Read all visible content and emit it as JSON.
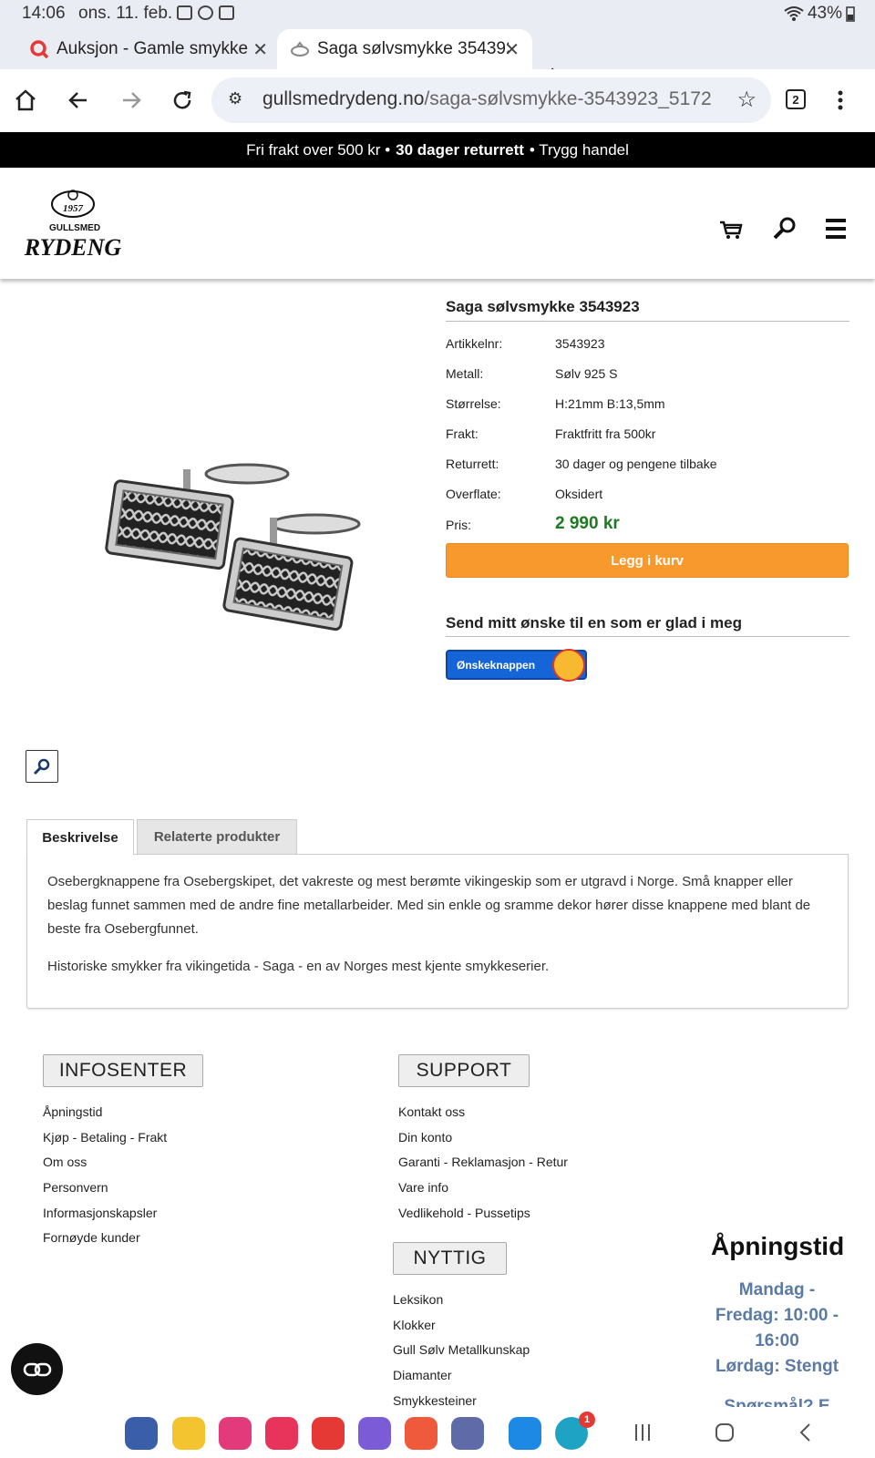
{
  "status_bar": {
    "time": "14:06",
    "date": "ons. 11. feb.",
    "battery": "43%"
  },
  "browser": {
    "tabs": [
      {
        "title": "Auksjon - Gamle smykker",
        "active": false,
        "icon": "search-icon"
      },
      {
        "title": "Saga sølvsmykke 3543923",
        "active": true,
        "icon": "ring-icon"
      }
    ],
    "url": "gullsmedrydeng.no/saga-sølvsmykke-3543923_5172",
    "url_domain": "gullsmedrydeng.no",
    "url_path": "/saga-sølvsmykke-3543923_5172",
    "tab_count": "2"
  },
  "promo": {
    "part1": "Fri frakt over 500 kr •",
    "part2": "30 dager returrett",
    "part3": "• Trygg handel"
  },
  "logo": {
    "year": "1957",
    "line1": "GULLSMED",
    "line2": "RYDENG"
  },
  "product": {
    "title": "Saga sølvsmykke 3543923",
    "specs": [
      {
        "label": "Artikkelnr:",
        "value": "3543923"
      },
      {
        "label": "Metall:",
        "value": "Sølv 925 S"
      },
      {
        "label": "Størrelse:",
        "value": "H:21mm B:13,5mm"
      },
      {
        "label": "Frakt:",
        "value": "Fraktfritt fra 500kr"
      },
      {
        "label": "Returrett:",
        "value": "30 dager og pengene tilbake"
      },
      {
        "label": "Overflate:",
        "value": "Oksidert"
      }
    ],
    "price_label": "Pris:",
    "price": "2 990 kr",
    "buy_label": "Legg i kurv",
    "wish_title": "Send mitt ønske til en som er glad i meg",
    "wish_button": "Ønskeknappen"
  },
  "tabs": {
    "description_label": "Beskrivelse",
    "related_label": "Relaterte produkter",
    "paragraph1": "Osebergknappene fra Osebergskipet, det vakreste og mest berømte vikingeskip som er utgravd i Norge. Små knapper eller beslag funnet sammen med de andre fine metallarbeider. Med sin enkle og sramme dekor hører disse knappene med blant de beste fra Osebergfunnet.",
    "paragraph2": "Historiske smykker fra vikingetida - Saga - en av Norges mest kjente smykkeserier."
  },
  "footer": {
    "infosenter": {
      "title": "INFOSENTER",
      "links": [
        "Åpningstid",
        "Kjøp - Betaling - Frakt",
        "Om oss",
        "Personvern",
        "Informasjonskapsler",
        "Fornøyde kunder"
      ]
    },
    "support": {
      "title": "SUPPORT",
      "links": [
        "Kontakt oss",
        "Din konto",
        "Garanti - Reklamasjon - Retur",
        "Vare info",
        "Vedlikehold - Pussetips"
      ]
    },
    "nyttig": {
      "title": "NYTTIG",
      "links": [
        "Leksikon",
        "Klokker",
        "Gull Sølv Metallkunskap",
        "Diamanter",
        "Smykkesteiner"
      ]
    },
    "hours": {
      "title": "Åpningstid",
      "lines": [
        "Mandag -",
        "Fredag: 10:00 -",
        "16:00",
        "Lørdag: Stengt",
        "Spørsmål? E"
      ]
    }
  },
  "colors": {
    "accent_orange": "#f8992e",
    "price_green": "#1d7a23",
    "hours_blue": "#5b7aa5",
    "wish_blue": "#1565d8"
  },
  "nav_badge": "1"
}
